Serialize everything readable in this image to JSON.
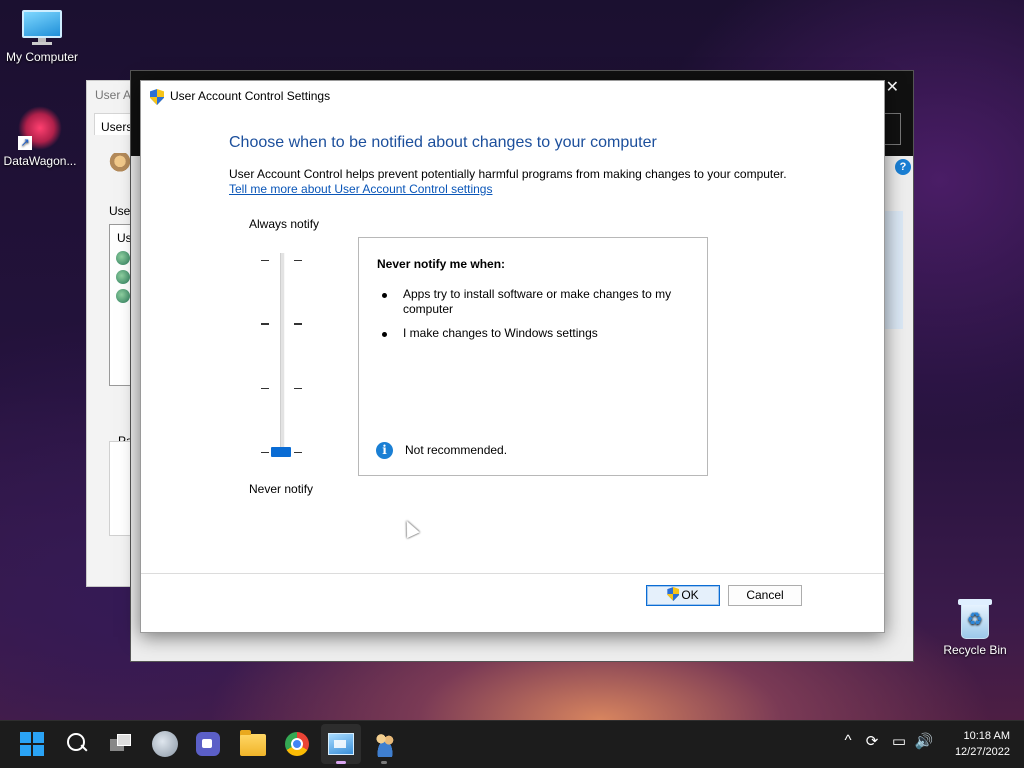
{
  "desktop": {
    "icons": [
      {
        "label": "My Computer",
        "icon": "monitor-icon"
      },
      {
        "label": "DataWagon...",
        "icon": "datawagon-shortcut-icon"
      },
      {
        "label": "Recycle Bin",
        "icon": "recycle-bin-icon"
      }
    ]
  },
  "background_window": {
    "title": "User A",
    "tab": "Users",
    "label_users": "User",
    "list_header": "Us",
    "label_password": "Pa"
  },
  "dialog": {
    "title": "User Account Control Settings",
    "heading": "Choose when to be notified about changes to your computer",
    "description": "User Account Control helps prevent potentially harmful programs from making changes to your computer.",
    "link": "Tell me more about User Account Control settings",
    "slider": {
      "top_label": "Always notify",
      "bottom_label": "Never notify",
      "levels": 4,
      "selected_level": 1
    },
    "info": {
      "heading": "Never notify me when:",
      "bullets": [
        "Apps try to install software or make changes to my computer",
        "I make changes to Windows settings"
      ],
      "note": "Not recommended."
    },
    "buttons": {
      "ok": "OK",
      "cancel": "Cancel"
    }
  },
  "taskbar": {
    "apps": [
      {
        "name": "start",
        "icon": "windows-start-icon"
      },
      {
        "name": "search",
        "icon": "search-icon"
      },
      {
        "name": "task-view",
        "icon": "task-view-icon"
      },
      {
        "name": "widgets",
        "icon": "widgets-icon"
      },
      {
        "name": "teams",
        "icon": "teams-chat-icon"
      },
      {
        "name": "file-explorer",
        "icon": "folder-icon"
      },
      {
        "name": "chrome",
        "icon": "chrome-icon"
      },
      {
        "name": "control-panel",
        "icon": "control-panel-icon"
      },
      {
        "name": "user-accounts",
        "icon": "user-accounts-icon"
      }
    ],
    "tray": {
      "chevron": "^",
      "sync": "⟳",
      "network": "▭",
      "volume": "🔊"
    },
    "clock": {
      "time": "10:18 AM",
      "date": "12/27/2022"
    }
  },
  "colors": {
    "accent": "#0a6cd4",
    "heading": "#1c4f9c",
    "link": "#0a56b8"
  }
}
